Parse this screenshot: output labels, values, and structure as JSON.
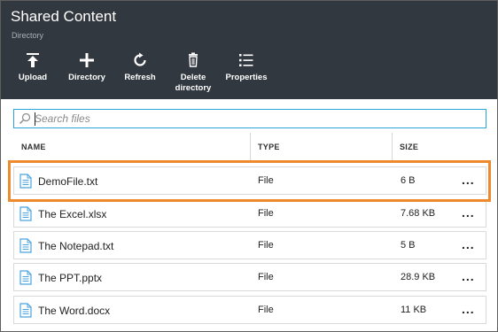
{
  "header": {
    "title": "Shared Content",
    "subtitle": "Directory"
  },
  "toolbar": [
    {
      "label": "Upload",
      "icon": "upload-icon"
    },
    {
      "label": "Directory",
      "icon": "plus-icon"
    },
    {
      "label": "Refresh",
      "icon": "refresh-icon"
    },
    {
      "label": "Delete",
      "label2": "directory",
      "icon": "trash-icon"
    },
    {
      "label": "Properties",
      "icon": "list-icon"
    }
  ],
  "search": {
    "placeholder": "Search files"
  },
  "columns": {
    "name": "NAME",
    "type": "TYPE",
    "size": "SIZE"
  },
  "files": [
    {
      "name": "DemoFile.txt",
      "type": "File",
      "size": "6 B",
      "more": "..."
    },
    {
      "name": "The Excel.xlsx",
      "type": "File",
      "size": "7.68 KB",
      "more": "..."
    },
    {
      "name": "The Notepad.txt",
      "type": "File",
      "size": "5 B",
      "more": "..."
    },
    {
      "name": "The PPT.pptx",
      "type": "File",
      "size": "28.9 KB",
      "more": "..."
    },
    {
      "name": "The Word.docx",
      "type": "File",
      "size": "11 KB",
      "more": "..."
    }
  ],
  "colors": {
    "header_bg": "#32383f",
    "accent": "#2aa3d8",
    "highlight": "#ee8a2e",
    "file_icon": "#4aa3df"
  }
}
